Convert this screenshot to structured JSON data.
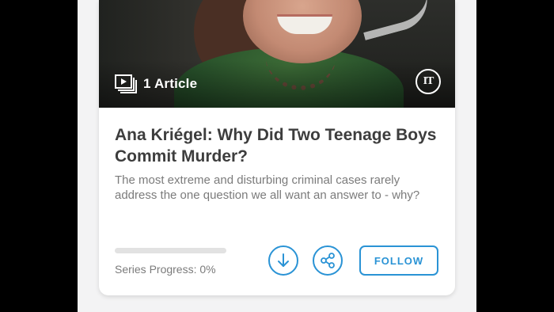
{
  "card": {
    "badge": {
      "icon": "media-stack-icon",
      "label": "1 Article"
    },
    "publisher": {
      "logo_text": "IT"
    },
    "title": "Ana Kriégel: Why Did Two Teenage Boys Commit Murder?",
    "description": "The most extreme and disturbing criminal cases rarely address the one question we all want an answer to - why?",
    "progress": {
      "label": "Series Progress: 0%",
      "value": 0
    },
    "actions": {
      "download_icon": "download-icon",
      "share_icon": "share-icon",
      "follow_label": "FOLLOW"
    }
  },
  "colors": {
    "accent": "#2a93d5",
    "title_text": "#3d3d3d",
    "body_text": "#7b7b7b",
    "progress_track": "#e2e2e2"
  }
}
